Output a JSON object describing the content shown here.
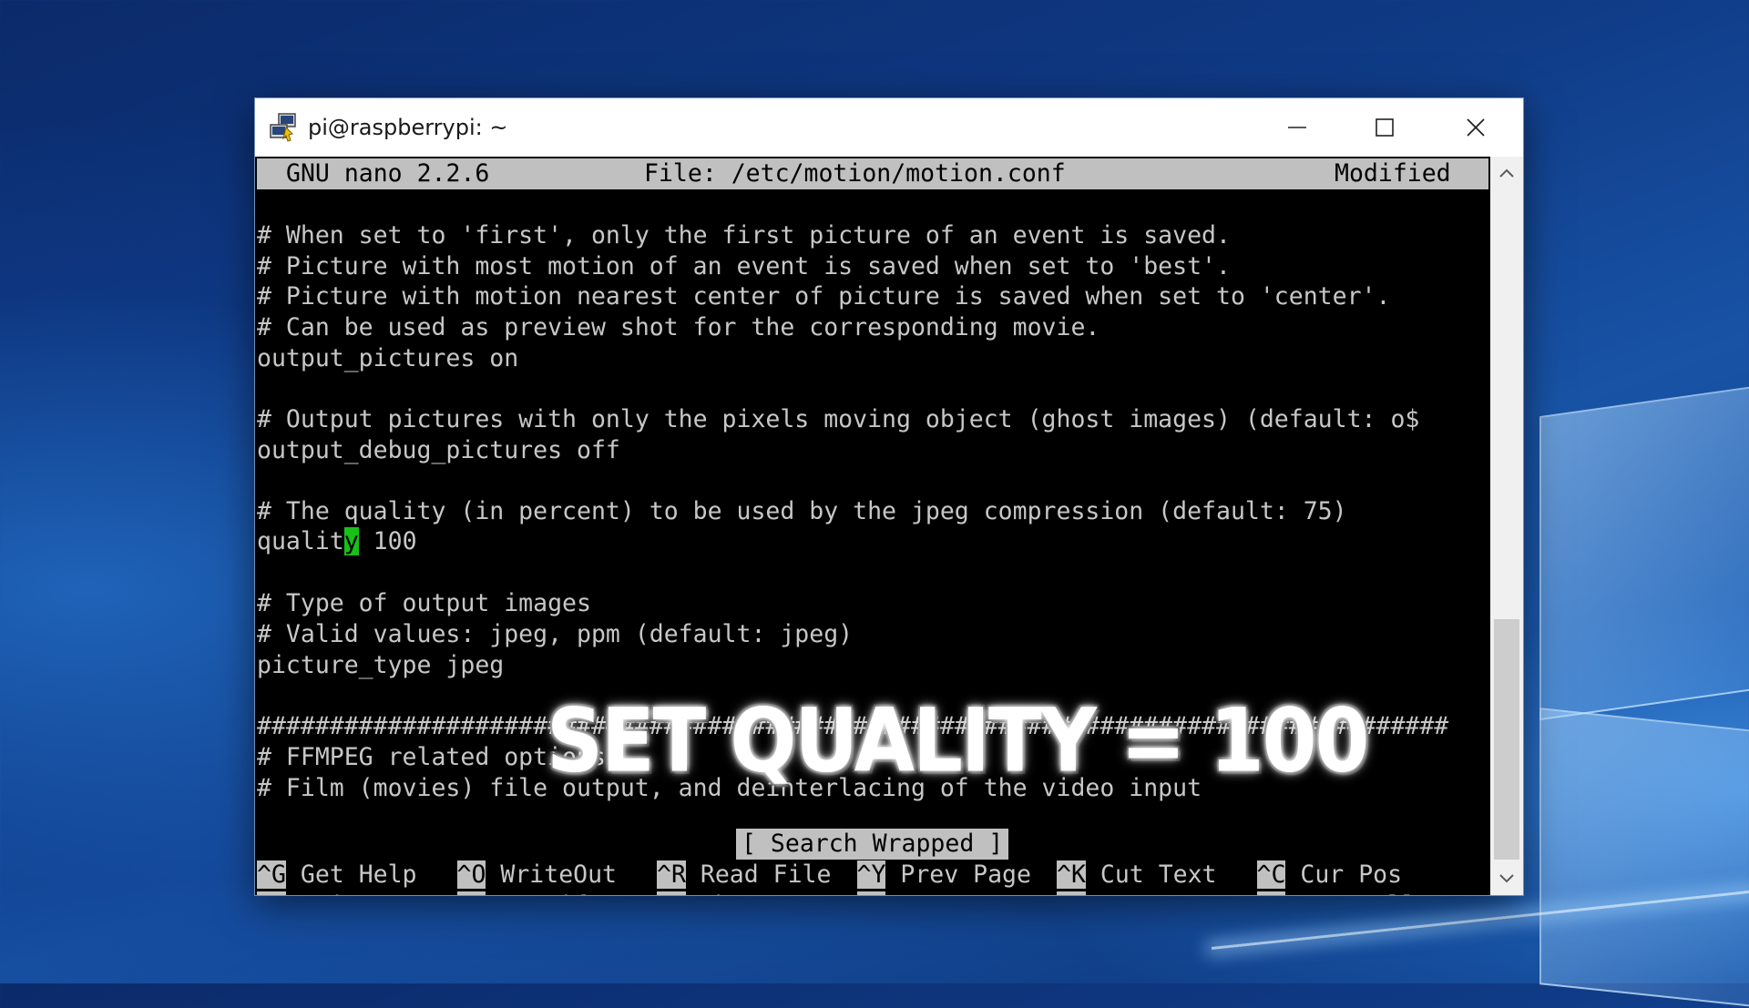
{
  "window": {
    "title": "pi@raspberrypi: ~",
    "minimize_icon": "minimize-icon",
    "maximize_icon": "maximize-icon",
    "close_icon": "close-icon",
    "app_icon": "putty-icon"
  },
  "nano": {
    "version": "GNU nano 2.2.6",
    "file": "File: /etc/motion/motion.conf",
    "state": "Modified"
  },
  "editor_lines": [
    "# When set to 'first', only the first picture of an event is saved.",
    "# Picture with most motion of an event is saved when set to 'best'.",
    "# Picture with motion nearest center of picture is saved when set to 'center'.",
    "# Can be used as preview shot for the corresponding movie.",
    "output_pictures on",
    "",
    "# Output pictures with only the pixels moving object (ghost images) (default: o$",
    "output_debug_pictures off",
    "",
    "# The quality (in percent) to be used by the jpeg compression (default: 75)",
    "",
    "",
    "# Type of output images",
    "# Valid values: jpeg, ppm (default: jpeg)",
    "picture_type jpeg",
    "",
    "##################################################################################",
    "# FFMPEG related options",
    "# Film (movies) file output, and deinterlacing of the video input"
  ],
  "cursor_line": {
    "before": "qualit",
    "cursor_char": "y",
    "after": " 100"
  },
  "status_message": "[ Search Wrapped ]",
  "shortcuts_row1": [
    {
      "key": "^G",
      "label": " Get Help"
    },
    {
      "key": "^O",
      "label": " WriteOut"
    },
    {
      "key": "^R",
      "label": " Read File"
    },
    {
      "key": "^Y",
      "label": " Prev Page"
    },
    {
      "key": "^K",
      "label": " Cut Text"
    },
    {
      "key": "^C",
      "label": " Cur Pos"
    }
  ],
  "shortcuts_row2": [
    {
      "key": "^X",
      "label": " Exit"
    },
    {
      "key": "^J",
      "label": " Justify"
    },
    {
      "key": "^W",
      "label": " Where Is"
    },
    {
      "key": "^V",
      "label": " Next Page"
    },
    {
      "key": "^U",
      "label": " UnCut Text"
    },
    {
      "key": "^T",
      "label": " To Spell"
    }
  ],
  "overlay_caption": "SET QUALITY = 100",
  "colors": {
    "terminal_bg": "#000000",
    "terminal_fg": "#c7c7c7",
    "cursor": "#18c018",
    "header_bg": "#c0c0c0"
  }
}
